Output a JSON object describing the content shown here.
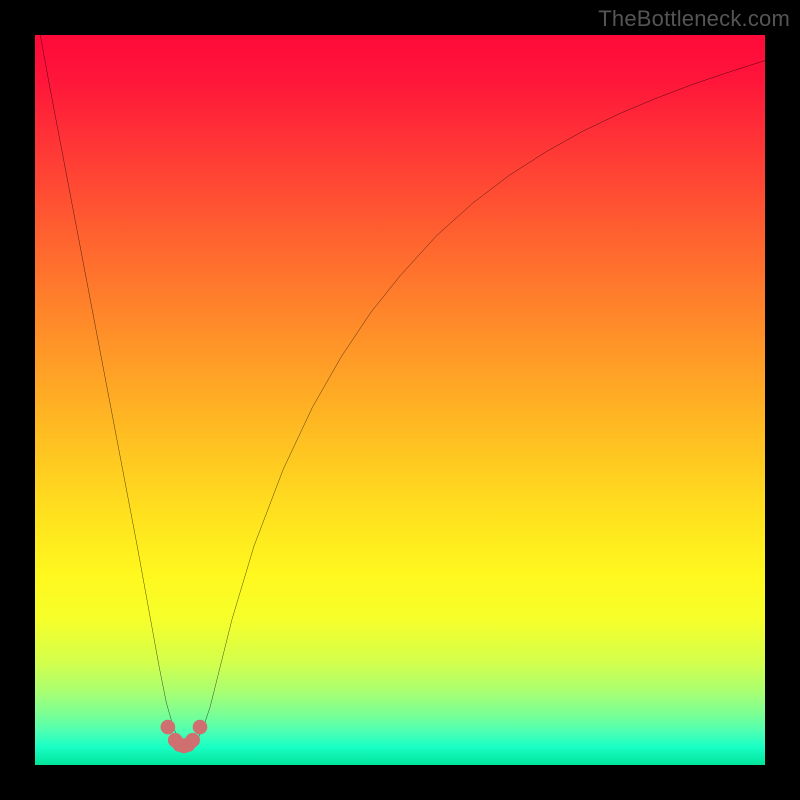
{
  "watermark": "TheBottleneck.com",
  "chart_data": {
    "type": "line",
    "title": "",
    "xlabel": "",
    "ylabel": "",
    "xlim": [
      0,
      100
    ],
    "ylim": [
      0,
      100
    ],
    "grid": false,
    "series": [
      {
        "name": "bottleneck-curve",
        "color": "#000000",
        "x": [
          0,
          2,
          4,
          6,
          8,
          10,
          12,
          14,
          16,
          17,
          18,
          19,
          20,
          21,
          22,
          23,
          24,
          25,
          27,
          30,
          34,
          38,
          42,
          46,
          50,
          55,
          60,
          65,
          70,
          75,
          80,
          85,
          90,
          95,
          100
        ],
        "y": [
          104,
          93,
          82.5,
          72,
          61.5,
          51,
          40.5,
          30,
          19,
          13.5,
          8.5,
          5,
          3,
          2.5,
          3,
          5,
          8,
          12,
          20,
          30,
          40.5,
          49,
          56,
          62,
          67,
          72.5,
          77,
          80.8,
          84,
          86.8,
          89.2,
          91.3,
          93.2,
          94.9,
          96.5
        ]
      },
      {
        "name": "optimal-zone-dots",
        "color": "#cf6f6f",
        "x": [
          18.2,
          19.2,
          19.8,
          20.4,
          21.0,
          21.6,
          22.6
        ],
        "y": [
          5.2,
          3.4,
          2.8,
          2.6,
          2.8,
          3.4,
          5.2
        ]
      }
    ],
    "background_gradient": {
      "stops": [
        {
          "offset": 0.0,
          "color": "#ff0a3a"
        },
        {
          "offset": 0.06,
          "color": "#ff153a"
        },
        {
          "offset": 0.18,
          "color": "#ff4035"
        },
        {
          "offset": 0.3,
          "color": "#ff6a2e"
        },
        {
          "offset": 0.42,
          "color": "#ff9328"
        },
        {
          "offset": 0.54,
          "color": "#ffbb22"
        },
        {
          "offset": 0.66,
          "color": "#ffe21e"
        },
        {
          "offset": 0.74,
          "color": "#fff81e"
        },
        {
          "offset": 0.8,
          "color": "#f6ff2a"
        },
        {
          "offset": 0.86,
          "color": "#d3ff4c"
        },
        {
          "offset": 0.9,
          "color": "#a8ff72"
        },
        {
          "offset": 0.93,
          "color": "#7bff94"
        },
        {
          "offset": 0.955,
          "color": "#4bffb4"
        },
        {
          "offset": 0.975,
          "color": "#1affc5"
        },
        {
          "offset": 1.0,
          "color": "#00e59a"
        }
      ]
    }
  }
}
